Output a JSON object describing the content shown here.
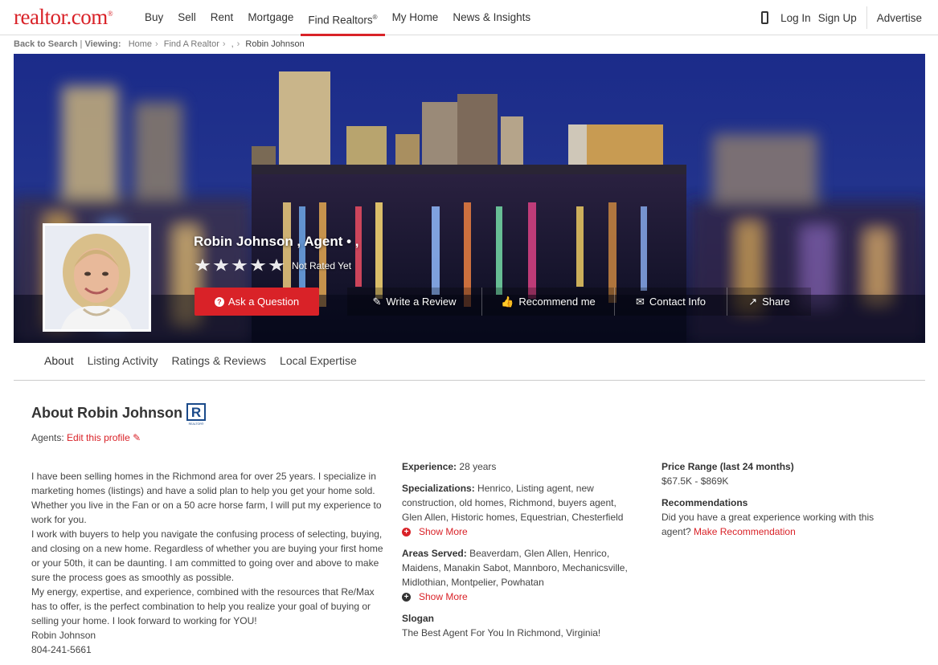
{
  "brand": {
    "logo_text": "realtor.com",
    "logo_mark": "®"
  },
  "nav": {
    "items": [
      {
        "label": "Buy"
      },
      {
        "label": "Sell"
      },
      {
        "label": "Rent"
      },
      {
        "label": "Mortgage"
      },
      {
        "label": "Find Realtors"
      },
      {
        "label": "My Home"
      },
      {
        "label": "News & Insights"
      }
    ],
    "find_realtors_sup": "®",
    "login": "Log In",
    "signup": "Sign Up",
    "advertise": "Advertise"
  },
  "breadcrumb": {
    "back": "Back to Search",
    "viewing": "Viewing:",
    "items": [
      "Home",
      "Find A Realtor",
      ",",
      "Robin Johnson"
    ]
  },
  "profile": {
    "name_line": "Robin Johnson , Agent • ,",
    "rating_text": "Not Rated Yet",
    "rating_stars": 0,
    "ask_button": "Ask a Question",
    "actions": [
      {
        "label": "Write a Review",
        "icon": "edit-icon"
      },
      {
        "label": "Recommend me",
        "icon": "thumbs-up-icon"
      },
      {
        "label": "Contact Info",
        "icon": "envelope-icon"
      },
      {
        "label": "Share",
        "icon": "share-icon"
      }
    ]
  },
  "tabs": [
    {
      "label": "About"
    },
    {
      "label": "Listing Activity"
    },
    {
      "label": "Ratings & Reviews"
    },
    {
      "label": "Local Expertise"
    }
  ],
  "about": {
    "title": "About Robin Johnson",
    "badge_text": "REALTOR®",
    "agents_label": "Agents:",
    "edit_link": "Edit this profile",
    "bio": [
      "I have been selling homes in the Richmond area for over 25 years. I specialize in marketing homes (listings) and have a solid plan to help you get your home sold. Whether you live in the Fan or on a 50 acre horse farm, I will put my experience to work for you.",
      "I work with buyers to help you navigate the confusing process of selecting, buying, and closing on a new home. Regardless of whether you are buying your first home or your 50th, it can be daunting. I am committed to going over and above to make sure the process goes as smoothly as possible.",
      "My energy, expertise, and experience, combined with the resources that Re/Max has to offer, is the perfect combination to help you realize your goal of buying or selling your home. I look forward to working for YOU!",
      "Robin Johnson",
      "804-241-5661"
    ]
  },
  "details": {
    "experience_label": "Experience:",
    "experience_value": "28 years",
    "specializations_label": "Specializations:",
    "specializations_value": "Henrico, Listing agent, new construction, old homes, Richmond, buyers agent, Glen Allen, Historic homes, Equestrian, Chesterfield",
    "show_more_1": "Show More",
    "areas_label": "Areas Served:",
    "areas_value": "Beaverdam, Glen Allen, Henrico, Maidens, Manakin Sabot, Mannboro, Mechanicsville, Midlothian, Montpelier, Powhatan",
    "show_more_2": "Show More",
    "slogan_label": "Slogan",
    "slogan_value": "The Best Agent For You In Richmond, Virginia!"
  },
  "side": {
    "price_label": "Price Range (last 24 months)",
    "price_value": "$67.5K - $869K",
    "rec_label": "Recommendations",
    "rec_text": "Did you have a great experience working with this agent?",
    "rec_link": "Make Recommendation"
  }
}
